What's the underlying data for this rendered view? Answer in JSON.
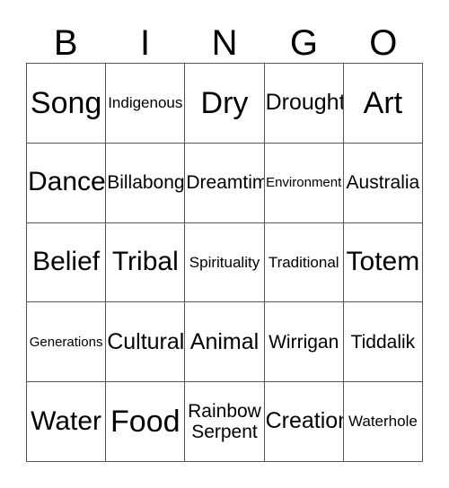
{
  "card": {
    "header_letters": [
      "B",
      "I",
      "N",
      "G",
      "O"
    ],
    "columns": 5,
    "rows": 5,
    "border_color": "#555555",
    "text_color": "#000000",
    "background_color": "#ffffff",
    "cells": [
      [
        {
          "text": "Song",
          "size": "fs-xxl"
        },
        {
          "text": "Indigenous",
          "size": "fs-s"
        },
        {
          "text": "Dry",
          "size": "fs-xxl"
        },
        {
          "text": "Drought",
          "size": "fs-l"
        },
        {
          "text": "Art",
          "size": "fs-xxl"
        }
      ],
      [
        {
          "text": "Dance",
          "size": "fs-xl"
        },
        {
          "text": "Billabong",
          "size": "fs-m"
        },
        {
          "text": "Dreamtime",
          "size": "fs-m"
        },
        {
          "text": "Environment",
          "size": "fs-xs"
        },
        {
          "text": "Australia",
          "size": "fs-m"
        }
      ],
      [
        {
          "text": "Belief",
          "size": "fs-xl"
        },
        {
          "text": "Tribal",
          "size": "fs-xl"
        },
        {
          "text": "Spirituality",
          "size": "fs-s"
        },
        {
          "text": "Traditional",
          "size": "fs-s"
        },
        {
          "text": "Totem",
          "size": "fs-xl"
        }
      ],
      [
        {
          "text": "Generations",
          "size": "fs-xs"
        },
        {
          "text": "Cultural",
          "size": "fs-l"
        },
        {
          "text": "Animal",
          "size": "fs-l"
        },
        {
          "text": "Wirrigan",
          "size": "fs-m"
        },
        {
          "text": "Tiddalik",
          "size": "fs-m"
        }
      ],
      [
        {
          "text": "Water",
          "size": "fs-xl"
        },
        {
          "text": "Food",
          "size": "fs-xxl"
        },
        {
          "text": "Rainbow\nSerpent",
          "size": "fs-m",
          "two_line": true
        },
        {
          "text": "Creation",
          "size": "fs-l"
        },
        {
          "text": "Waterhole",
          "size": "fs-s"
        }
      ]
    ]
  }
}
